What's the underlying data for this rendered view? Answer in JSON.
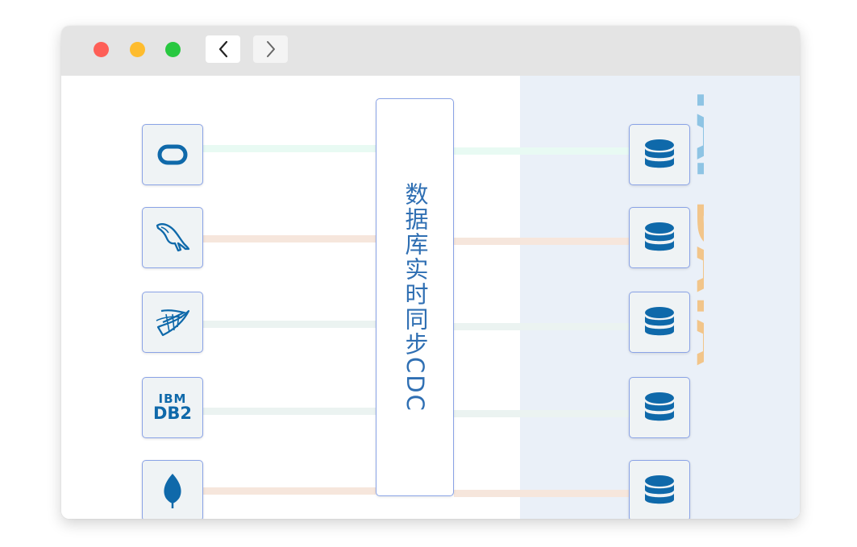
{
  "window": {
    "nav": {
      "back_icon": "chevron-left-icon",
      "forward_icon": "chevron-right-icon"
    }
  },
  "diagram": {
    "hub_label": "数据库实时同步CDC",
    "sources": [
      {
        "name": "Oracle",
        "icon": "oracle-icon"
      },
      {
        "name": "MySQL",
        "icon": "mysql-dolphin-icon"
      },
      {
        "name": "SQL Server",
        "icon": "sqlserver-icon"
      },
      {
        "name": "IBM DB2",
        "icon": "ibm-db2-icon",
        "label_top": "IBM",
        "label_bottom": "DB2"
      },
      {
        "name": "MongoDB",
        "icon": "mongodb-leaf-icon"
      }
    ],
    "targets_icon": "database-icon",
    "connector_colors": [
      "#e8faf3",
      "#f6e6dc",
      "#ebf3f1",
      "#ebf3f1",
      "#f6e6dc"
    ],
    "brand": {
      "text": "TAPDATA",
      "color_blue": "#8ec4e4",
      "color_orange": "#f2c58a"
    }
  },
  "colors": {
    "icon_blue": "#0f69aa",
    "hub_text": "#2f6fb3",
    "node_border": "#8aa3e6"
  }
}
